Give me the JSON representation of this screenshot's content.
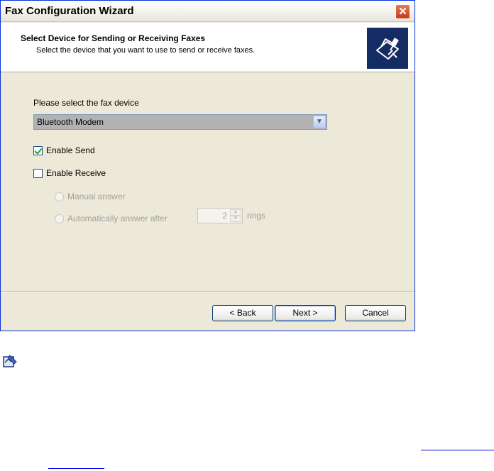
{
  "window": {
    "title": "Fax Configuration Wizard",
    "close_glyph": "✕"
  },
  "header": {
    "title": "Select Device for Sending or Receiving Faxes",
    "subtitle": "Select the device that you want to use to send or receive faxes.",
    "icon": "fax-machine-icon"
  },
  "device": {
    "label": "Please select the fax device",
    "selected": "Bluetooth Modem"
  },
  "options": {
    "enable_send": {
      "label": "Enable Send",
      "checked": true
    },
    "enable_receive": {
      "label": "Enable Receive",
      "checked": false
    },
    "manual_answer": {
      "label": "Manual answer",
      "disabled": true
    },
    "auto_answer": {
      "label": "Automatically answer after",
      "disabled": true
    },
    "rings_value": "2",
    "rings_label": "rings"
  },
  "buttons": {
    "back": "< Back",
    "next": "Next >",
    "cancel": "Cancel"
  },
  "colors": {
    "header_icon_bg": "#152b63",
    "window_bg": "#ece9d8",
    "link": "#0000ee"
  }
}
